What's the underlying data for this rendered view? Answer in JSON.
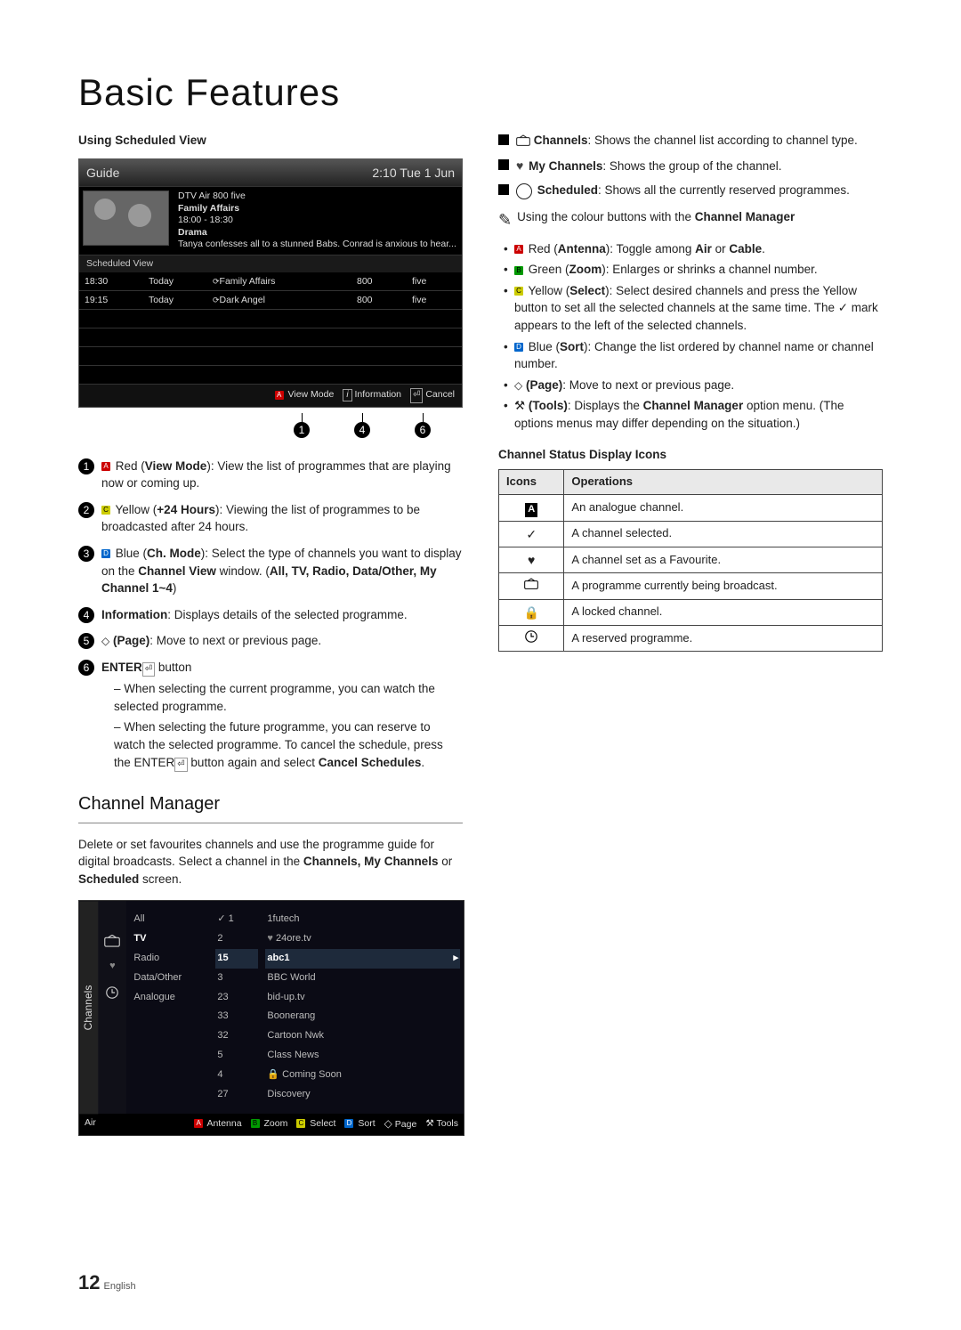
{
  "page": {
    "title": "Basic Features",
    "number": "12",
    "lang": "English"
  },
  "left": {
    "scheduled_heading": "Using Scheduled View",
    "guide": {
      "title": "Guide",
      "clock": "2:10 Tue 1 Jun",
      "meta_line1": "DTV Air 800 five",
      "meta_line2": "Family Affairs",
      "meta_line3": "18:00 - 18:30",
      "meta_line4": "Drama",
      "meta_desc": "Tanya confesses all to a stunned Babs. Conrad is anxious to hear...",
      "tab": "Scheduled View",
      "rows": [
        {
          "time": "18:30",
          "day": "Today",
          "prog": "Family Affairs",
          "num": "800",
          "ch": "five"
        },
        {
          "time": "19:15",
          "day": "Today",
          "prog": "Dark Angel",
          "num": "800",
          "ch": "five"
        }
      ],
      "footer": {
        "viewmode": "View Mode",
        "information": "Information",
        "cancel": "Cancel"
      },
      "callouts": [
        "1",
        "4",
        "6"
      ]
    },
    "items": {
      "1": {
        "marker": "Red",
        "label": "View Mode",
        "text": ": View the list of programmes that are playing now or coming up."
      },
      "2": {
        "marker": "Yellow",
        "label": "+24 Hours",
        "text": ": Viewing the list of programmes to be broadcasted after 24 hours."
      },
      "3": {
        "marker": "Blue",
        "label": "Ch. Mode",
        "text_a": ": Select the type of channels you want to display on the ",
        "text_b": "Channel View",
        "text_c": " window. (",
        "opts": "All, TV, Radio, Data/Other, My Channel 1~4",
        "text_d": ")"
      },
      "4": {
        "label": "Information",
        "text": ": Displays details of the selected programme."
      },
      "5": {
        "label": "(Page)",
        "text": ": Move to next or previous page."
      },
      "6": {
        "label_a": "ENTER",
        "label_b": " button",
        "sub1": "When selecting the current programme, you can watch the selected programme.",
        "sub2_pre": "When selecting the future programme, you can reserve to watch the selected programme. To cancel the schedule, press the ENTER",
        "sub2_post": " button again and select ",
        "sub2_bold": "Cancel Schedules",
        "sub2_end": "."
      }
    },
    "cm_heading": "Channel Manager",
    "cm_intro_a": "Delete or set favourites channels and use the programme guide for digital broadcasts. Select a channel in the ",
    "cm_intro_b": "Channels, My Channels",
    "cm_intro_c": " or ",
    "cm_intro_d": "Scheduled",
    "cm_intro_e": " screen.",
    "cm_fig": {
      "vtab": "Channels",
      "cats": [
        "All",
        "TV",
        "Radio",
        "Data/Other",
        "Analogue"
      ],
      "cat_sel_index": 1,
      "nums": [
        "1",
        "2",
        "15",
        "3",
        "23",
        "33",
        "32",
        "5",
        "4",
        "27"
      ],
      "num_sel_index": 2,
      "names": [
        "1futech",
        "24ore.tv",
        "abc1",
        "BBC World",
        "bid-up.tv",
        "Boonerang",
        "Cartoon Nwk",
        "Class News",
        "Coming Soon",
        "Discovery"
      ],
      "name_sel_index": 2,
      "footer_left": "Air",
      "footer": {
        "antenna": "Antenna",
        "zoom": "Zoom",
        "select": "Select",
        "sort": "Sort",
        "page": "Page",
        "tools": "Tools"
      }
    }
  },
  "right": {
    "blocks": [
      {
        "icon": "antenna",
        "label": "Channels",
        "text": ": Shows the channel list according to channel type."
      },
      {
        "icon": "heart",
        "label": "My Channels",
        "text": ": Shows the group of the channel."
      },
      {
        "icon": "clock",
        "label": "Scheduled",
        "text": ": Shows all the currently reserved programmes."
      }
    ],
    "note_pre": "Using the colour buttons with the ",
    "note_bold": "Channel Manager",
    "cbullets": {
      "red": {
        "label": "Antenna",
        "text_a": "Red (",
        "text_b": "): Toggle among ",
        "opt1": "Air",
        "mid": " or ",
        "opt2": "Cable",
        "end": "."
      },
      "green": {
        "label": "Zoom",
        "text_a": "Green (",
        "text_b": "): Enlarges or shrinks a channel number."
      },
      "yellow": {
        "label": "Select",
        "text_a": "Yellow (",
        "text_b": "): Select desired channels and press the Yellow button to set all the selected channels at the same time. The ✓ mark appears to the left of the selected channels."
      },
      "blue": {
        "label": "Sort",
        "text_a": "Blue (",
        "text_b": "): Change the list ordered by channel name or channel number."
      },
      "page": {
        "label": "(Page)",
        "text": ": Move to next or previous page."
      },
      "tools": {
        "label": "(Tools)",
        "text_a": ": Displays the ",
        "bold": "Channel Manager",
        "text_b": " option menu. (The options menus may differ depending on the situation.)"
      }
    },
    "status_heading": "Channel Status Display Icons",
    "status_th": {
      "icons": "Icons",
      "ops": "Operations"
    },
    "status_rows": [
      {
        "icon": "A",
        "text": "An analogue channel."
      },
      {
        "icon": "✓",
        "text": "A channel selected."
      },
      {
        "icon": "♥",
        "text": "A channel set as a Favourite."
      },
      {
        "icon": "tv",
        "text": "A programme currently being broadcast."
      },
      {
        "icon": "lock",
        "text": "A locked channel."
      },
      {
        "icon": "clock",
        "text": "A reserved programme."
      }
    ]
  }
}
